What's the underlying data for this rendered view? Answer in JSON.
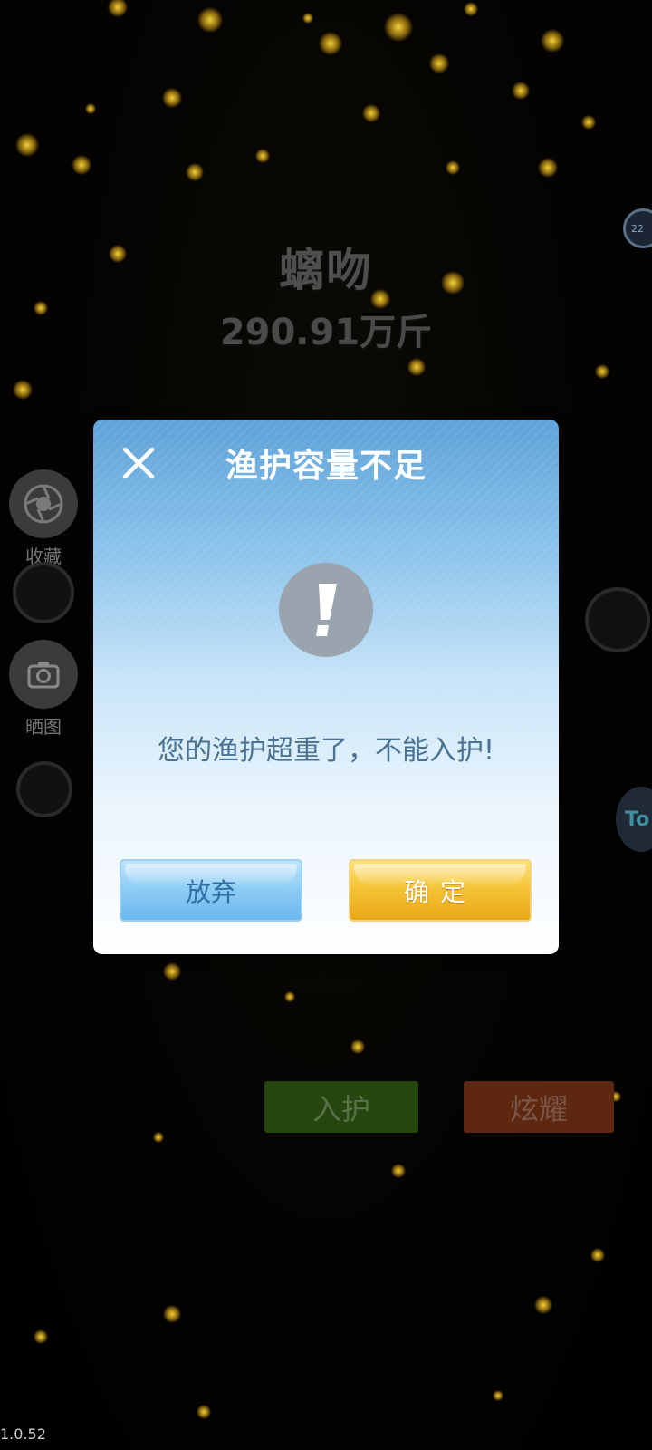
{
  "fish": {
    "name": "螭吻",
    "weight": "290.91万斤"
  },
  "side_buttons": {
    "collect_label": "收藏",
    "share_label": "晒图"
  },
  "right_badges": {
    "badge_top_text": "22",
    "badge_mid_text": "To"
  },
  "actions": {
    "guard_label": "入护",
    "show_label": "炫耀"
  },
  "dialog": {
    "title": "渔护容量不足",
    "message": "您的渔护超重了，不能入护!",
    "cancel_label": "放弃",
    "ok_label": "确定"
  },
  "version": "1.0.52",
  "colors": {
    "dialog_header": "#5ea2d8",
    "cancel_button": "#8fcdf5",
    "ok_button": "#f6c437",
    "guard_button": "#25460f",
    "show_button": "#5d2710",
    "particle": "#ffd83c"
  }
}
